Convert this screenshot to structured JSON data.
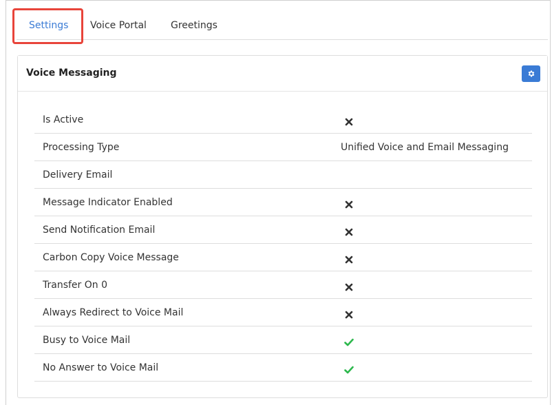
{
  "tabs": [
    {
      "label": "Settings",
      "active": true
    },
    {
      "label": "Voice Portal",
      "active": false
    },
    {
      "label": "Greetings",
      "active": false
    }
  ],
  "panel": {
    "title": "Voice Messaging",
    "settings_icon": "gear-icon"
  },
  "rows": [
    {
      "label": "Is Active",
      "value": "",
      "status": "false"
    },
    {
      "label": "Processing Type",
      "value": "Unified Voice and Email Messaging",
      "status": "text"
    },
    {
      "label": "Delivery Email",
      "value": "",
      "status": "empty"
    },
    {
      "label": "Message Indicator Enabled",
      "value": "",
      "status": "false"
    },
    {
      "label": "Send Notification Email",
      "value": "",
      "status": "false"
    },
    {
      "label": "Carbon Copy Voice Message",
      "value": "",
      "status": "false"
    },
    {
      "label": "Transfer On 0",
      "value": "",
      "status": "false"
    },
    {
      "label": "Always Redirect to Voice Mail",
      "value": "",
      "status": "false"
    },
    {
      "label": "Busy to Voice Mail",
      "value": "",
      "status": "true"
    },
    {
      "label": "No Answer to Voice Mail",
      "value": "",
      "status": "true"
    }
  ],
  "colors": {
    "accent": "#3a7bd5",
    "highlight": "#e8443a",
    "check": "#2db84d",
    "cross": "#333333"
  }
}
